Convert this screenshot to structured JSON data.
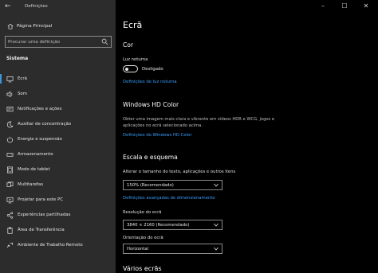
{
  "window": {
    "app_title": "Definições",
    "controls": [
      "minimize",
      "maximize",
      "close"
    ]
  },
  "sidebar": {
    "home_label": "Página Principal",
    "search_placeholder": "Procurar uma definição",
    "section_label": "Sistema",
    "items": [
      {
        "label": "Ecrã",
        "icon": "display-icon",
        "active": true
      },
      {
        "label": "Som",
        "icon": "speaker-icon"
      },
      {
        "label": "Notificações e ações",
        "icon": "notifications-icon"
      },
      {
        "label": "Auxiliar de concentração",
        "icon": "moon-icon"
      },
      {
        "label": "Energia e suspensão",
        "icon": "power-icon"
      },
      {
        "label": "Armazenamento",
        "icon": "storage-icon"
      },
      {
        "label": "Modo de tablet",
        "icon": "tablet-icon"
      },
      {
        "label": "Multitarefas",
        "icon": "multitask-icon"
      },
      {
        "label": "Projetar para este PC",
        "icon": "project-icon"
      },
      {
        "label": "Experiências partilhadas",
        "icon": "share-icon"
      },
      {
        "label": "Área de Transferência",
        "icon": "clipboard-icon"
      },
      {
        "label": "Ambiente de Trabalho Remoto",
        "icon": "remote-icon"
      }
    ]
  },
  "main": {
    "title": "Ecrã",
    "color_section": {
      "heading": "Cor",
      "night_light_label": "Luz noturna",
      "toggle_state": "Desligado",
      "night_light_link": "Definições de luz noturna"
    },
    "hd_section": {
      "heading": "Windows HD Color",
      "description": "Obter uma imagem mais clara e vibrante em vídeos HDR e WCG, jogos e aplicações no ecrã selecionado acima.",
      "link": "Definições do Windows HD Color"
    },
    "scale_section": {
      "heading": "Escala e esquema",
      "text_size_label": "Alterar o tamanho do texto, aplicações e outros itens",
      "text_size_value": "150% (Recomendado)",
      "advanced_link": "Definições avançadas de dimensionamento",
      "resolution_label": "Resolução do ecrã",
      "resolution_value": "3840 × 2160 (Recomendado)",
      "orientation_label": "Orientação do ecrã",
      "orientation_value": "Horizontal"
    },
    "multi_display_heading": "Vários ecrãs"
  },
  "colors": {
    "sidebar_bg": "#2c2c2c",
    "main_bg": "#000000",
    "accent": "#3a96dd",
    "link": "#3aa0ff"
  }
}
